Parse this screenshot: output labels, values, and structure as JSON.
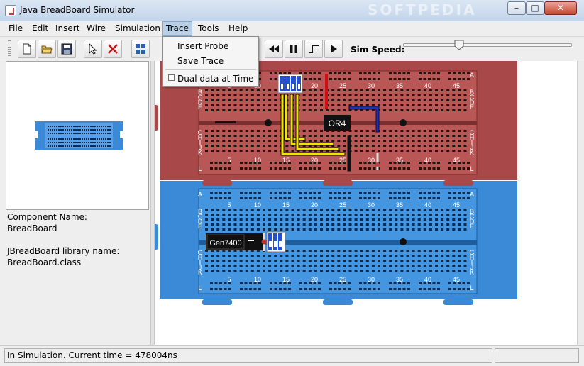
{
  "window": {
    "title": "Java BreadBoard Simulator",
    "watermark": "SOFTPEDIA"
  },
  "menu": {
    "items": [
      {
        "label": "File"
      },
      {
        "label": "Edit"
      },
      {
        "label": "Insert"
      },
      {
        "label": "Wire"
      },
      {
        "label": "Simulation"
      },
      {
        "label": "Trace"
      },
      {
        "label": "Tools"
      },
      {
        "label": "Help"
      }
    ],
    "active": "Trace"
  },
  "trace_menu": {
    "insert_probe": "Insert Probe",
    "save_trace": "Save Trace",
    "dual_data": "Dual data at Time",
    "dual_data_checked": false
  },
  "toolbar": {
    "buttons": [
      "new-file-icon",
      "open-folder-icon",
      "save-disk-icon",
      "select-arrow-icon",
      "delete-x-icon",
      "chip-icon"
    ],
    "sim_buttons": [
      "rewind-icon",
      "pause-icon",
      "step-icon",
      "play-icon"
    ],
    "sim_speed_label": "Sim Speed:",
    "sim_speed_fraction": 0.33
  },
  "info": {
    "component_name_label": "Component Name:",
    "component_name": "BreadBoard",
    "library_label": "JBreadBoard library name:",
    "library_name": "BreadBoard.class"
  },
  "board": {
    "top_color": "#a84848",
    "bottom_color": "#3a8ad8",
    "column_numbers": [
      "5",
      "10",
      "15",
      "20",
      "25",
      "30",
      "35",
      "40",
      "45"
    ],
    "row_letters_upper": [
      "A",
      "B",
      "C",
      "D",
      "E"
    ],
    "row_letters_lower": [
      "G",
      "H",
      "I",
      "J",
      "K",
      "L"
    ],
    "chips": {
      "top": "OR4",
      "bottom": "Gen7400"
    }
  },
  "status": {
    "text": "In Simulation.  Current time = 478004ns"
  }
}
